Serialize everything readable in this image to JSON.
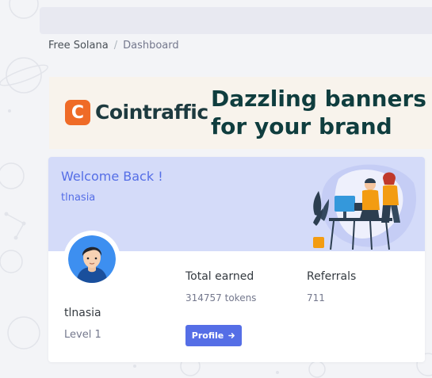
{
  "breadcrumb": {
    "root": "Free Solana",
    "separator": "/",
    "current": "Dashboard"
  },
  "ad_banner": {
    "brand": "Cointraffic",
    "logo_letter": "C",
    "tagline_line1": "Dazzling banners",
    "tagline_line2": "for your brand",
    "colors": {
      "logo": "#ef6b27",
      "tagline": "#0f3d3e",
      "background": "#f8f3ec"
    }
  },
  "welcome_card": {
    "title": "Welcome Back !",
    "subtitle": "tlnasia",
    "username": "tlnasia",
    "level": "Level 1",
    "stats": [
      {
        "label": "Total earned",
        "value": "314757 tokens"
      },
      {
        "label": "Referrals",
        "value": "711"
      }
    ],
    "profile_button": {
      "label": "Profile",
      "icon": "arrow-right-icon"
    },
    "colors": {
      "accent": "#556ee6",
      "header_bg": "#d4dbf9"
    }
  }
}
